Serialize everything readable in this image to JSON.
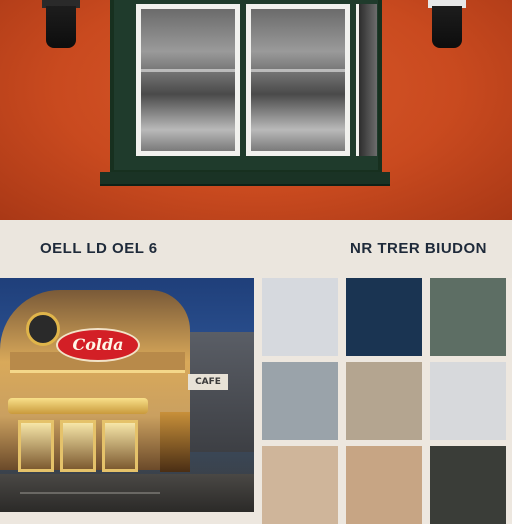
{
  "captions": {
    "left": "OELL LD OEL 6",
    "right": "NR TRER BIUDON"
  },
  "storefront": {
    "sign_text": "Colda",
    "small_sign_text": "CAFE"
  },
  "palette": {
    "swatches": [
      {
        "name": "swatch-light-gray",
        "color": "#d6d9de"
      },
      {
        "name": "swatch-navy",
        "color": "#1a3452"
      },
      {
        "name": "swatch-sage",
        "color": "#5d6e64"
      },
      {
        "name": "swatch-slate-gray",
        "color": "#9aa3aa"
      },
      {
        "name": "swatch-taupe",
        "color": "#b4a590"
      },
      {
        "name": "swatch-pale-gray",
        "color": "#d7d9dc"
      },
      {
        "name": "swatch-sand",
        "color": "#cfb59a"
      },
      {
        "name": "swatch-tan",
        "color": "#c7a584"
      },
      {
        "name": "swatch-charcoal",
        "color": "#3a3d38"
      }
    ]
  },
  "colors": {
    "wall": "#c94a1f",
    "window_frame": "#1f3b2c",
    "caption_text": "#1e2a3a",
    "sign_red": "#d31f26"
  }
}
